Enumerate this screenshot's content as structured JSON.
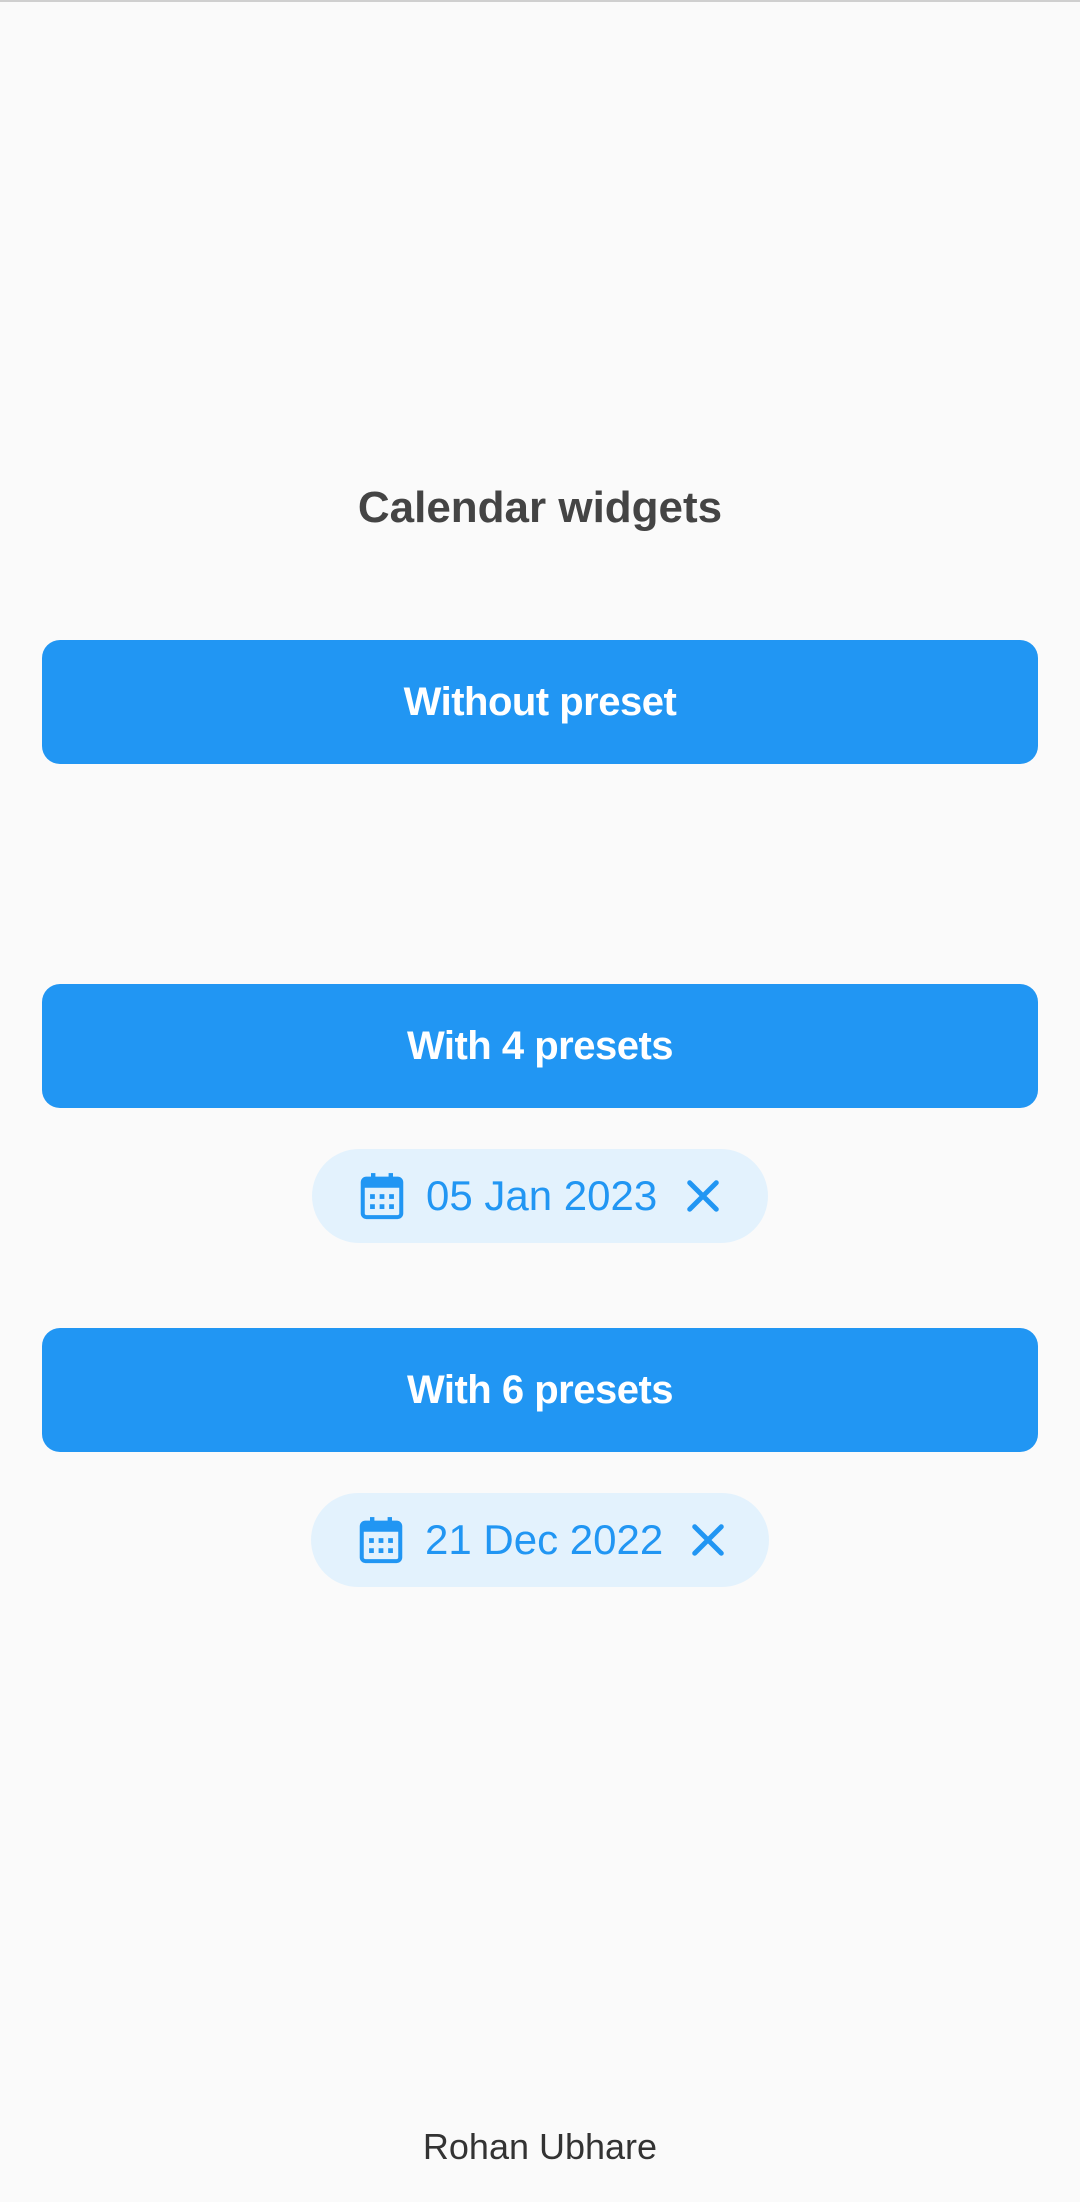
{
  "header": {
    "title": "Calendar widgets"
  },
  "buttons": {
    "without_preset": "Without preset",
    "with_4_presets": "With 4 presets",
    "with_6_presets": "With 6 presets"
  },
  "chips": [
    {
      "date": "05 Jan 2023",
      "icon": "calendar-icon",
      "action_icon": "close-icon"
    },
    {
      "date": "21 Dec 2022",
      "icon": "calendar-icon",
      "action_icon": "close-icon"
    }
  ],
  "footer": {
    "author": "Rohan Ubhare"
  },
  "colors": {
    "accent": "#2196f3",
    "chip_bg": "#e3f2fd",
    "background": "#fafafa",
    "title_text": "#444444"
  }
}
